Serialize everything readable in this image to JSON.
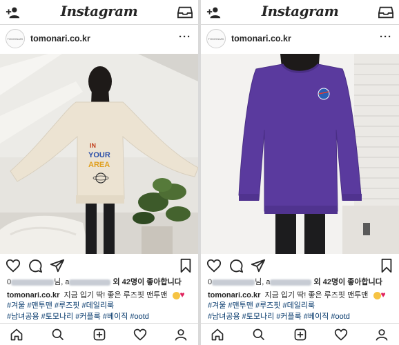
{
  "app": {
    "title": "Instagram"
  },
  "icons": {
    "add_user": "add-user-icon",
    "inbox": "inbox-icon",
    "more": "more-options-icon",
    "like": "heart-icon",
    "comment": "comment-icon",
    "share": "direct-share-icon",
    "save": "bookmark-icon",
    "home": "home-icon",
    "search": "search-icon",
    "new_post": "new-post-icon",
    "activity": "activity-heart-icon",
    "profile": "profile-icon"
  },
  "colors": {
    "hashtag": "#003569",
    "sweater_purple": "#5a3a9e",
    "sweater_cream": "#ece3d2"
  },
  "posts": [
    {
      "account": "tomonari.co.kr",
      "avatar_text": "TOMONARI",
      "more_label": "···",
      "print_text": {
        "line1": "IN",
        "line2": "YOUR",
        "line3": "AREA"
      },
      "likes": {
        "prefix": "0",
        "mid": "님, a",
        "count_text": "외 42명이 좋아합니다"
      },
      "caption": {
        "user": "tomonari.co.kr",
        "text": "지금 입기 딱! 좋은 루즈핏 맨투맨"
      },
      "tags_line1": "#겨울 #맨투맨 #루즈핏 #데일리룩",
      "tags_line2": "#남녀공용 #토모나리 #커플룩 #베이직 #ootd"
    },
    {
      "account": "tomonari.co.kr",
      "avatar_text": "TOMONARI",
      "more_label": "···",
      "likes": {
        "prefix": "0",
        "mid": "님, a",
        "count_text": "외 42명이 좋아합니다"
      },
      "caption": {
        "user": "tomonari.co.kr",
        "text": "지금 입기 딱! 좋은 루즈핏 맨투맨"
      },
      "tags_line1": "#겨울 #맨투맨 #루즈핏 #데일리룩",
      "tags_line2": "#남녀공용 #토모나리 #커플룩 #베이직 #ootd"
    }
  ]
}
